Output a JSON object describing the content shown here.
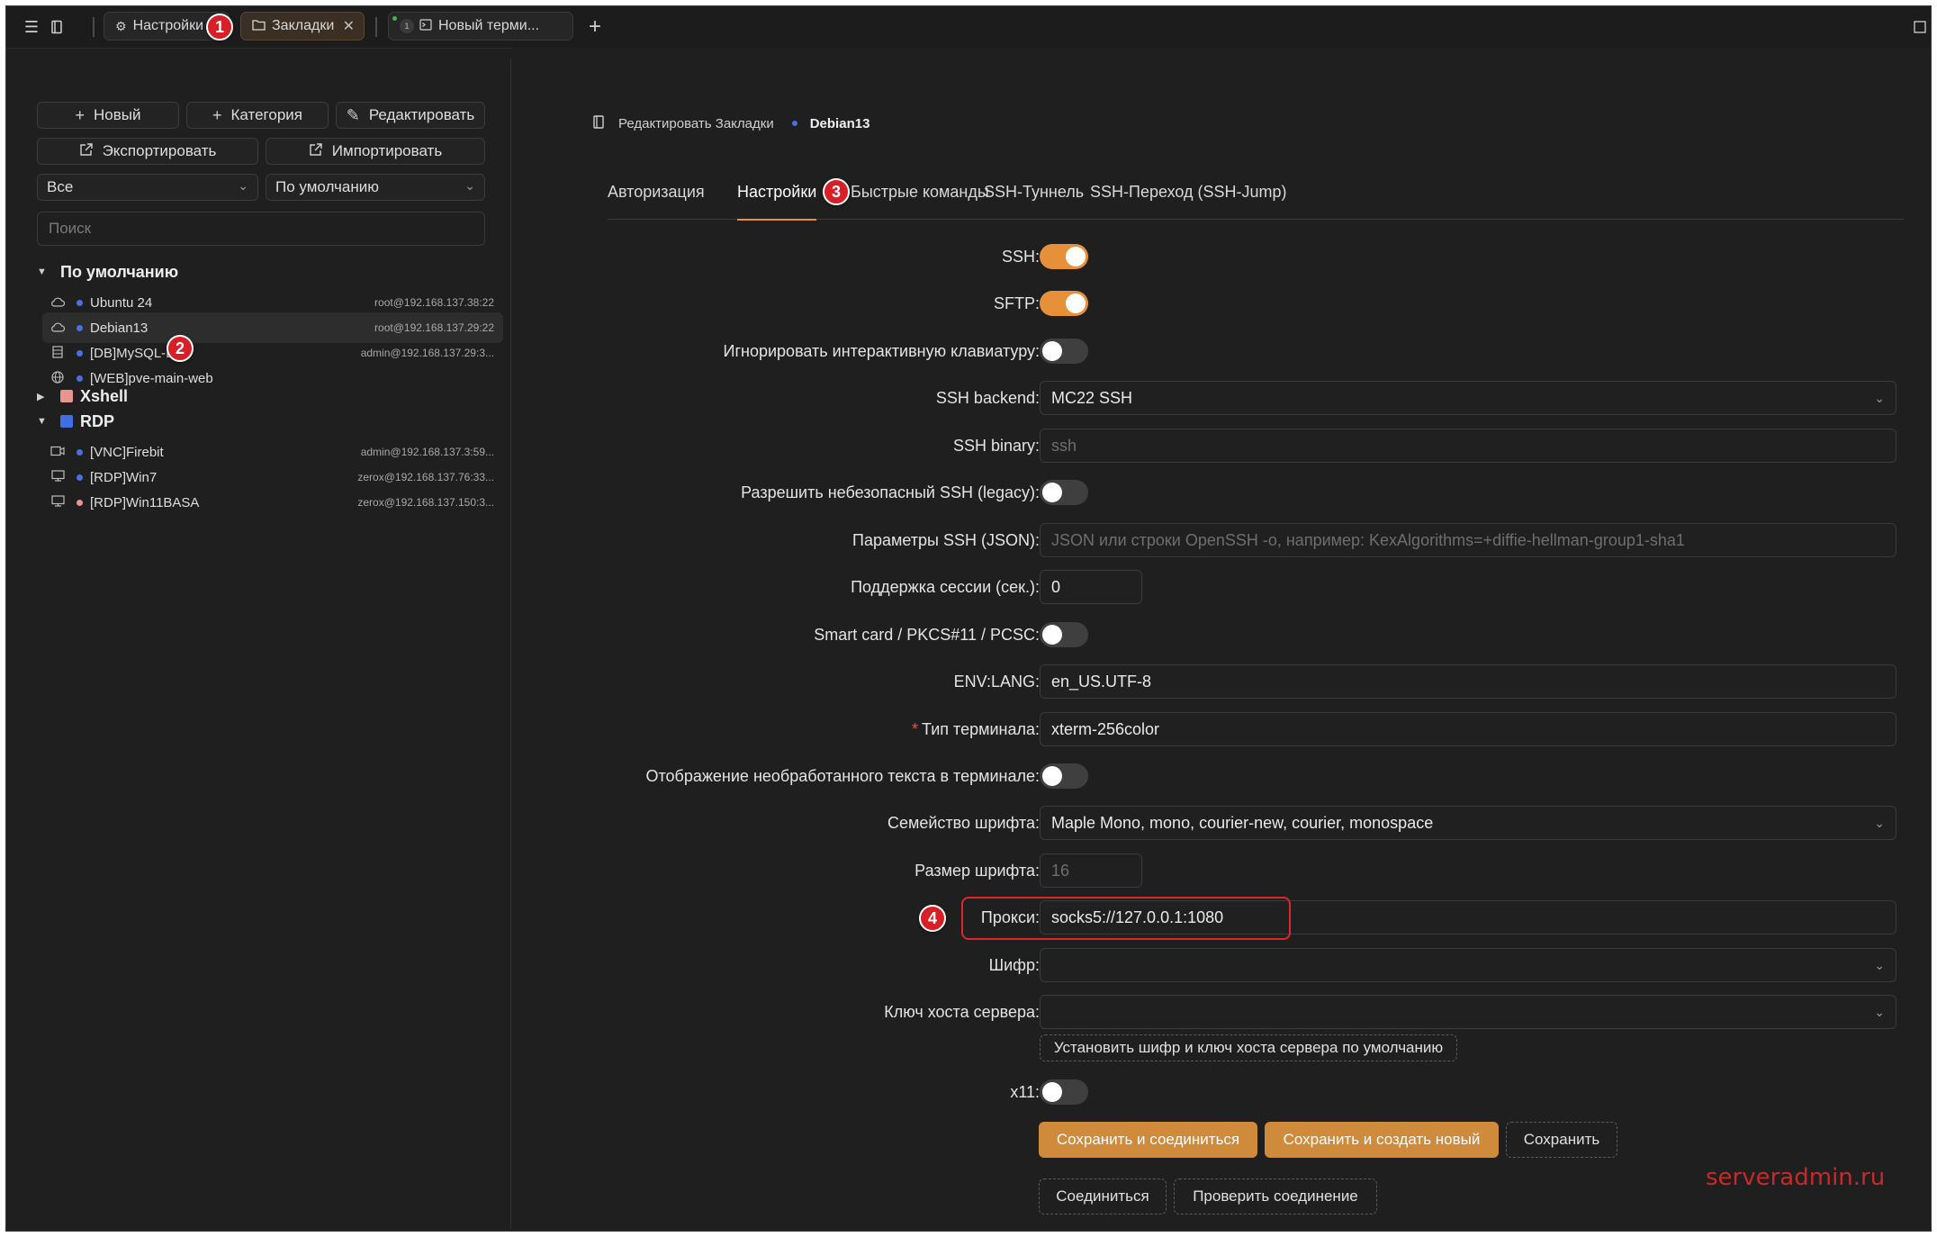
{
  "topbar": {
    "tabs": [
      {
        "label": "Настройки"
      },
      {
        "label": "Закладки"
      },
      {
        "label": "Новый терми...",
        "number": "1"
      }
    ]
  },
  "badges": [
    "1",
    "2",
    "3",
    "4"
  ],
  "sidebar": {
    "buttons": {
      "new": "Новый",
      "category": "Категория",
      "edit": "Редактировать",
      "export": "Экспортировать",
      "import": "Импортировать"
    },
    "filter_select": "Все",
    "sort_select": "По умолчанию",
    "search_placeholder": "Поиск",
    "groups": [
      {
        "name": "По умолчанию",
        "expanded": true
      },
      {
        "name": "Xshell",
        "expanded": false,
        "color": "#e8958f"
      },
      {
        "name": "RDP",
        "expanded": true,
        "color": "#3f6fe0"
      }
    ],
    "items": [
      {
        "name": "Ubuntu 24",
        "host": "root@192.168.137.38:22",
        "icon": "cloud-icon",
        "dot": "#4a6fe3"
      },
      {
        "name": "Debian13",
        "host": "root@192.168.137.29:22",
        "icon": "cloud-icon",
        "dot": "#4a6fe3",
        "selected": true
      },
      {
        "name": "[DB]MySQL-DB",
        "host": "admin@192.168.137.29:3...",
        "icon": "database-icon",
        "dot": "#4a6fe3"
      },
      {
        "name": "[WEB]pve-main-web",
        "host": "",
        "icon": "globe-icon",
        "dot": "#4a6fe3"
      },
      {
        "name": "[VNC]Firebit",
        "host": "admin@192.168.137.3:59...",
        "icon": "vnc-icon",
        "dot": "#4a6fe3"
      },
      {
        "name": "[RDP]Win7",
        "host": "zerox@192.168.137.76:33...",
        "icon": "monitor-icon",
        "dot": "#4a6fe3"
      },
      {
        "name": "[RDP]Win11BASA",
        "host": "zerox@192.168.137.150:3...",
        "icon": "monitor-icon",
        "dot": "#e8958f"
      }
    ]
  },
  "breadcrumb": {
    "parent": "Редактировать Закладки",
    "current": "Debian13"
  },
  "tabs": [
    "Авторизация",
    "Настройки",
    "Быстрые команды",
    "SSH-Туннель",
    "SSH-Переход (SSH-Jump)"
  ],
  "form": {
    "ssh": {
      "label": "SSH:",
      "on": true
    },
    "sftp": {
      "label": "SFTP:",
      "on": true
    },
    "ignore_kbd": {
      "label": "Игнорировать интерактивную клавиатуру:",
      "on": false
    },
    "ssh_backend": {
      "label": "SSH backend:",
      "value": "MC22 SSH"
    },
    "ssh_binary": {
      "label": "SSH binary:",
      "placeholder": "ssh"
    },
    "legacy": {
      "label": "Разрешить небезопасный SSH (legacy):",
      "on": false
    },
    "ssh_params": {
      "label": "Параметры SSH (JSON):",
      "placeholder": "JSON или строки OpenSSH -o, например: KexAlgorithms=+diffie-hellman-group1-sha1"
    },
    "keepalive": {
      "label": "Поддержка сессии (сек.):",
      "value": "0"
    },
    "smartcard": {
      "label": "Smart card / PKCS#11 / PCSC:",
      "on": false
    },
    "env_lang": {
      "label": "ENV:LANG:",
      "value": "en_US.UTF-8"
    },
    "term_type": {
      "label": "Тип терминала:",
      "required_mark": "*",
      "value": "xterm-256color"
    },
    "raw_text": {
      "label": "Отображение необработанного текста в терминале:",
      "on": false
    },
    "font_family": {
      "label": "Семейство шрифта:",
      "value": "Maple Mono, mono, courier-new, courier, monospace"
    },
    "font_size": {
      "label": "Размер шрифта:",
      "placeholder": "16"
    },
    "proxy": {
      "label": "Прокси:",
      "value": "socks5://127.0.0.1:1080"
    },
    "cipher": {
      "label": "Шифр:",
      "value": ""
    },
    "host_key": {
      "label": "Ключ хоста сервера:",
      "value": ""
    },
    "default_cipher_button": "Установить шифр и ключ хоста сервера по умолчанию",
    "x11": {
      "label": "x11:",
      "on": false
    }
  },
  "actions": {
    "save_connect": "Сохранить и соединиться",
    "save_new": "Сохранить и создать новый",
    "save": "Сохранить",
    "connect": "Соединиться",
    "test": "Проверить соединение"
  },
  "watermark": "serveradmin.ru",
  "colors": {
    "accent": "#e6913a",
    "button": "#d08a3c",
    "highlight": "#e0262c",
    "link_dot": "#4a6fe3"
  }
}
